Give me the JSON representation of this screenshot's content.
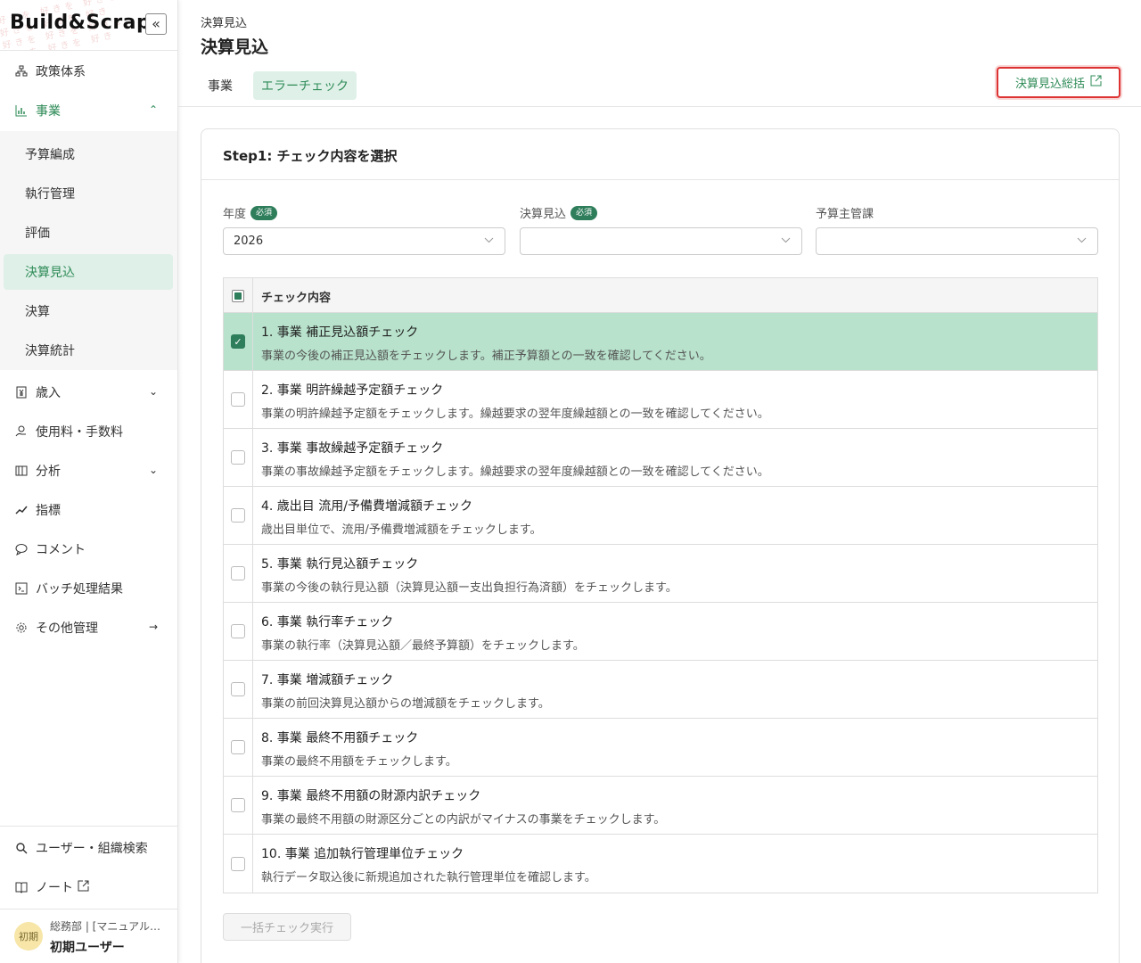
{
  "sidebar": {
    "logo": "Build&Scrap",
    "collapse_symbol": "«",
    "nav": [
      {
        "label": "政策体系",
        "icon": "hierarchy-icon"
      },
      {
        "label": "事業",
        "icon": "bar-chart-icon"
      },
      {
        "label": "歳入",
        "icon": "yen-document-icon"
      },
      {
        "label": "使用料・手数料",
        "icon": "coin-hand-icon"
      },
      {
        "label": "分析",
        "icon": "analysis-icon"
      },
      {
        "label": "指標",
        "icon": "trend-icon"
      },
      {
        "label": "コメント",
        "icon": "comment-icon"
      },
      {
        "label": "バッチ処理結果",
        "icon": "batch-icon"
      },
      {
        "label": "その他管理",
        "icon": "gear-icon"
      }
    ],
    "sub": [
      "予算編成",
      "執行管理",
      "評価",
      "決算見込",
      "決算",
      "決算統計"
    ],
    "bottom": [
      {
        "label": "ユーザー・組織検索",
        "icon": "search-icon"
      },
      {
        "label": "ノート",
        "icon": "book-icon"
      }
    ],
    "user": {
      "avatar": "初期",
      "dept": "総務部 | [マニュアル…",
      "name": "初期ユーザー"
    }
  },
  "header": {
    "breadcrumb": "決算見込",
    "title": "決算見込",
    "tabs": [
      "事業",
      "エラーチェック"
    ],
    "summary_button": "決算見込総括"
  },
  "card": {
    "title": "Step1: チェック内容を選択",
    "required_badge": "必須",
    "filters": [
      {
        "label": "年度",
        "value": "2026",
        "required": true
      },
      {
        "label": "決算見込",
        "value": "",
        "required": true
      },
      {
        "label": "予算主管課",
        "value": "",
        "required": false
      }
    ],
    "table_header": "チェック内容",
    "rows": [
      {
        "title": "1. 事業 補正見込額チェック",
        "desc": "事業の今後の補正見込額をチェックします。補正予算額との一致を確認してください。",
        "checked": true
      },
      {
        "title": "2. 事業 明許繰越予定額チェック",
        "desc": "事業の明許繰越予定額をチェックします。繰越要求の翌年度繰越額との一致を確認してください。",
        "checked": false
      },
      {
        "title": "3. 事業 事故繰越予定額チェック",
        "desc": "事業の事故繰越予定額をチェックします。繰越要求の翌年度繰越額との一致を確認してください。",
        "checked": false
      },
      {
        "title": "4. 歳出目 流用/予備費増減額チェック",
        "desc": "歳出目単位で、流用/予備費増減額をチェックします。",
        "checked": false
      },
      {
        "title": "5. 事業 執行見込額チェック",
        "desc": "事業の今後の執行見込額（決算見込額ー支出負担行為済額）をチェックします。",
        "checked": false
      },
      {
        "title": "6. 事業 執行率チェック",
        "desc": "事業の執行率（決算見込額／最終予算額）をチェックします。",
        "checked": false
      },
      {
        "title": "7. 事業 増減額チェック",
        "desc": "事業の前回決算見込額からの増減額をチェックします。",
        "checked": false
      },
      {
        "title": "8. 事業 最終不用額チェック",
        "desc": "事業の最終不用額をチェックします。",
        "checked": false
      },
      {
        "title": "9. 事業 最終不用額の財源内訳チェック",
        "desc": "事業の最終不用額の財源区分ごとの内訳がマイナスの事業をチェックします。",
        "checked": false
      },
      {
        "title": "10. 事業 追加執行管理単位チェック",
        "desc": "執行データ取込後に新規追加された執行管理単位を確認します。",
        "checked": false
      }
    ],
    "run_button": "一括チェック実行"
  },
  "colors": {
    "accent": "#2e8b57",
    "selected_row": "#b8e2cc",
    "highlight_border": "#d33"
  }
}
